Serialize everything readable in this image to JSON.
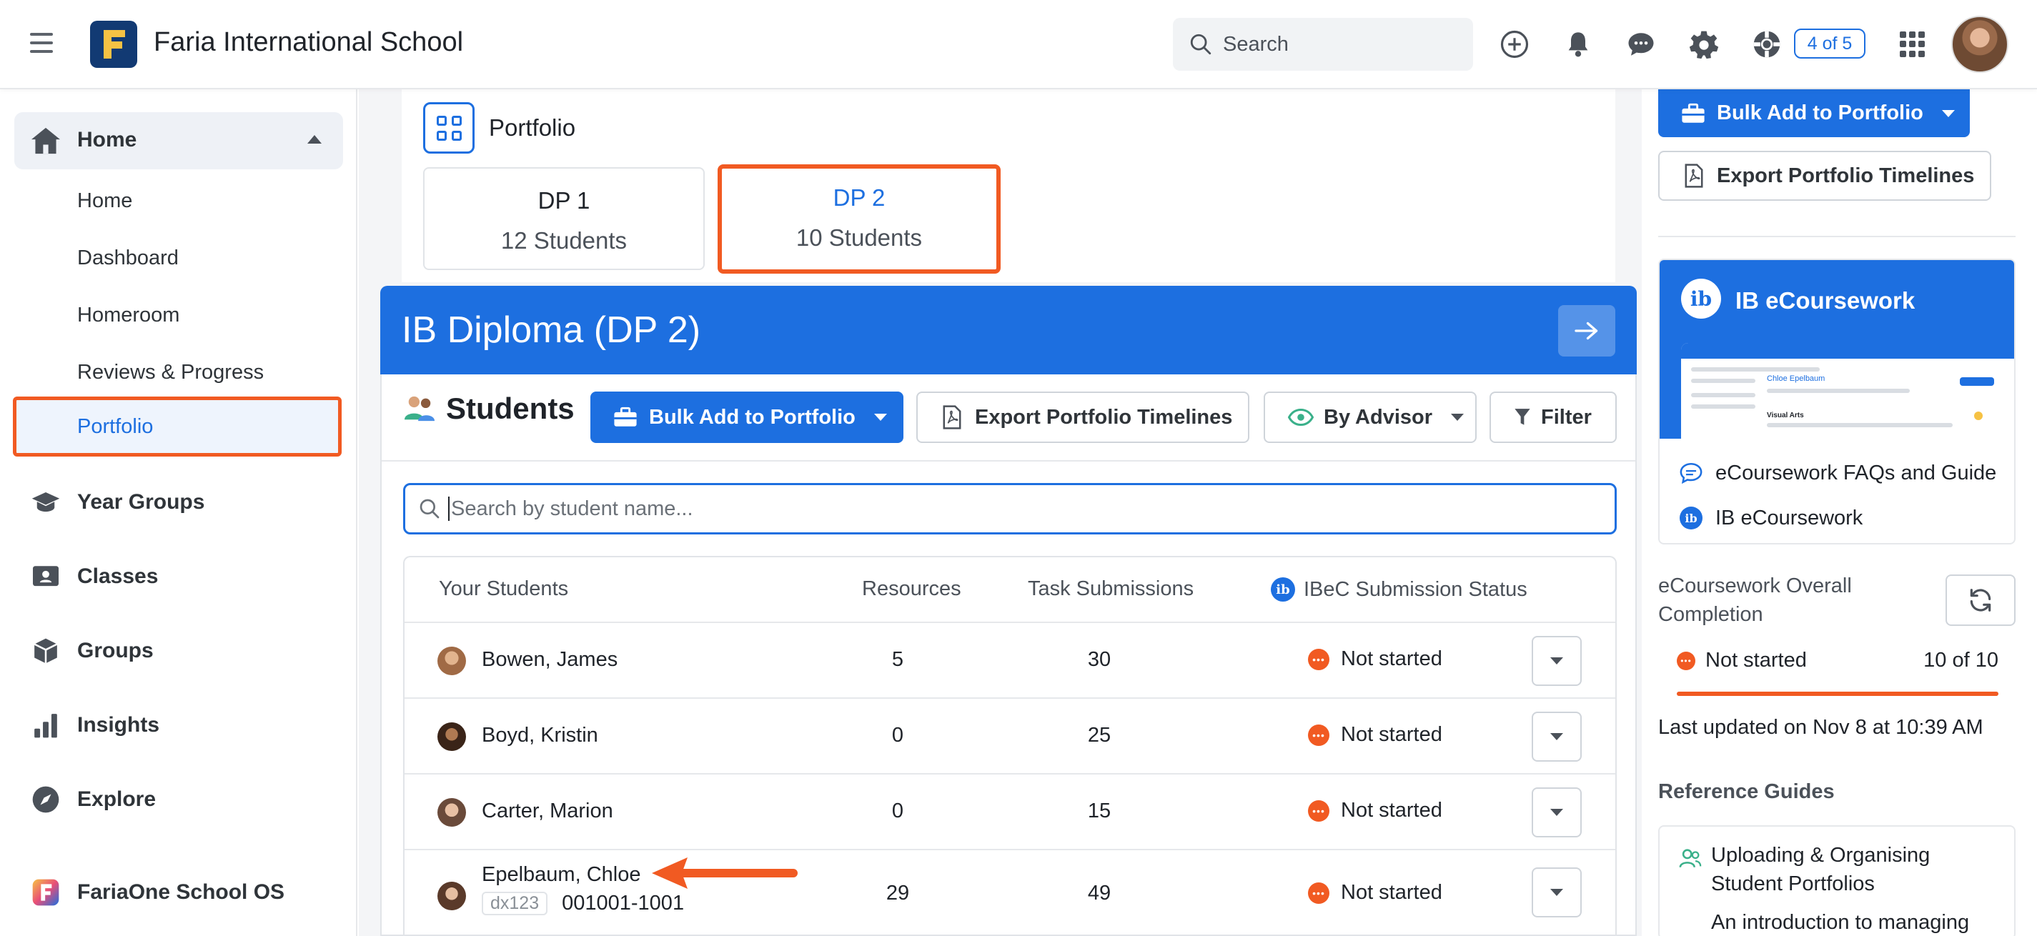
{
  "header": {
    "school_name": "Faria International School",
    "search_label": "Search",
    "notifications_badge": "4 of 5",
    "icons": [
      "menu-icon",
      "add-icon",
      "bell-icon",
      "chat-icon",
      "gear-icon",
      "help-icon",
      "apps-grid-icon"
    ]
  },
  "sidebar": {
    "home_section": "Home",
    "home_items": [
      "Home",
      "Dashboard",
      "Homeroom",
      "Reviews & Progress",
      "Portfolio"
    ],
    "active_item": "Portfolio",
    "nav": [
      {
        "label": "Year Groups",
        "icon": "graduation-cap-icon"
      },
      {
        "label": "Classes",
        "icon": "class-board-icon"
      },
      {
        "label": "Groups",
        "icon": "cube-icon"
      },
      {
        "label": "Insights",
        "icon": "bar-chart-icon"
      },
      {
        "label": "Explore",
        "icon": "compass-icon"
      },
      {
        "label": "FariaOne School OS",
        "icon": "faria-one-icon"
      }
    ]
  },
  "portfolio": {
    "title": "Portfolio",
    "tabs": [
      {
        "name": "DP 1",
        "count": "12 Students"
      },
      {
        "name": "DP 2",
        "count": "10 Students"
      }
    ],
    "active_tab": "DP 2"
  },
  "program": {
    "title": "IB Diploma (DP 2)"
  },
  "students": {
    "title": "Students",
    "bulk_add": "Bulk Add to Portfolio",
    "export": "Export Portfolio Timelines",
    "by_advisor": "By Advisor",
    "filter": "Filter",
    "search_placeholder": "Search by student name...",
    "columns": {
      "name": "Your Students",
      "resources": "Resources",
      "tasks": "Task Submissions",
      "ibec": "IBeC Submission Status"
    },
    "rows": [
      {
        "name": "Bowen, James",
        "resources": "5",
        "tasks": "30",
        "status": "Not started"
      },
      {
        "name": "Boyd, Kristin",
        "resources": "0",
        "tasks": "25",
        "status": "Not started"
      },
      {
        "name": "Carter, Marion",
        "resources": "0",
        "tasks": "15",
        "status": "Not started"
      },
      {
        "name": "Epelbaum, Chloe",
        "id_badge": "dx123",
        "id_number": "001001-1001",
        "resources": "29",
        "tasks": "49",
        "status": "Not started"
      }
    ],
    "status_color": "#f15a22"
  },
  "right_panel": {
    "bulk_add": "Bulk Add to Portfolio",
    "export": "Export Portfolio Timelines",
    "ecoursework": {
      "title": "IB eCoursework",
      "faq_link": "eCoursework FAQs and Guide",
      "ib_link": "IB eCoursework",
      "shot_text": "Chloe Epelbaum",
      "shot_subject": "Visual Arts"
    },
    "completion_label": "eCoursework Overall Completion",
    "completion_status": "Not started",
    "completion_count": "10 of 10",
    "completion_fraction": 1.0,
    "last_updated": "Last updated on Nov 8 at 10:39 AM",
    "reference_guides_title": "Reference Guides",
    "guide_title": "Uploading & Organising Student Portfolios",
    "guide_desc": "An introduction to managing"
  },
  "colors": {
    "primary": "#1d6fe0",
    "highlight": "#f15a22",
    "text": "#1f2329"
  }
}
